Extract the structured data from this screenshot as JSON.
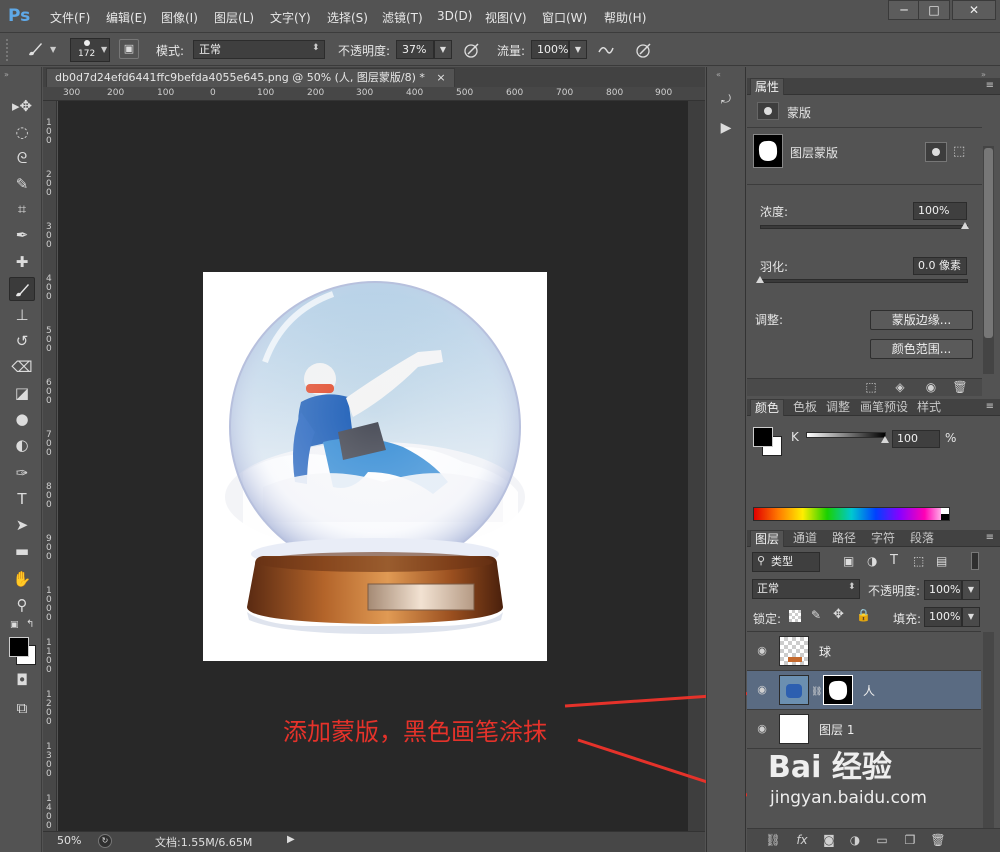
{
  "app": {
    "logo": "Ps",
    "menu": [
      "文件(F)",
      "编辑(E)",
      "图像(I)",
      "图层(L)",
      "文字(Y)",
      "选择(S)",
      "滤镜(T)",
      "3D(D)",
      "视图(V)",
      "窗口(W)",
      "帮助(H)"
    ],
    "window_buttons": [
      "─",
      "□",
      "✕"
    ]
  },
  "options": {
    "brush_size": "172",
    "mode_label": "模式:",
    "mode_value": "正常",
    "opacity_label": "不透明度:",
    "opacity_value": "37%",
    "flow_label": "流量:",
    "flow_value": "100%"
  },
  "document": {
    "tab_title": "db0d7d24efd6441ffc9befda4055e645.png @ 50% (人, 图层蒙版/8) *",
    "close_glyph": "×",
    "ruler_top": [
      "300",
      "200",
      "100",
      "0",
      "100",
      "200",
      "300",
      "400",
      "500",
      "600",
      "700",
      "800",
      "900"
    ],
    "ruler_left": [
      "100",
      "200",
      "300",
      "400",
      "500",
      "600",
      "700",
      "800",
      "900",
      "1000",
      "1100",
      "1200",
      "1300",
      "1400"
    ],
    "zoom": "50%",
    "doc_info": "文档:1.55M/6.65M"
  },
  "annotation": "添加蒙版，黑色画笔涂抹",
  "properties": {
    "tab": "属性",
    "mask_label": "蒙版",
    "layer_mask_label": "图层蒙版",
    "density_label": "浓度:",
    "density_value": "100%",
    "feather_label": "羽化:",
    "feather_value": "0.0 像素",
    "adjust_label": "调整:",
    "mask_edge_btn": "蒙版边缘...",
    "color_range_btn": "颜色范围..."
  },
  "color_panel": {
    "tabs": [
      "颜色",
      "色板",
      "调整",
      "画笔预设",
      "样式"
    ],
    "channel_label": "K",
    "channel_value": "100",
    "percent": "%"
  },
  "layers_panel": {
    "tabs": [
      "图层",
      "通道",
      "路径",
      "字符",
      "段落"
    ],
    "filter_value": "类型",
    "blend_mode": "正常",
    "opacity_label": "不透明度:",
    "opacity_value": "100%",
    "lock_label": "锁定:",
    "fill_label": "填充:",
    "fill_value": "100%",
    "layers": [
      {
        "name": "球",
        "selected": false
      },
      {
        "name": "人",
        "selected": true
      },
      {
        "name": "图层 1",
        "selected": false
      }
    ]
  },
  "watermark": {
    "brand": "Bai 经验",
    "url": "jingyan.baidu.com"
  },
  "colors": {
    "accent_selected": "#5a6b82",
    "annotation": "#e5322a"
  }
}
